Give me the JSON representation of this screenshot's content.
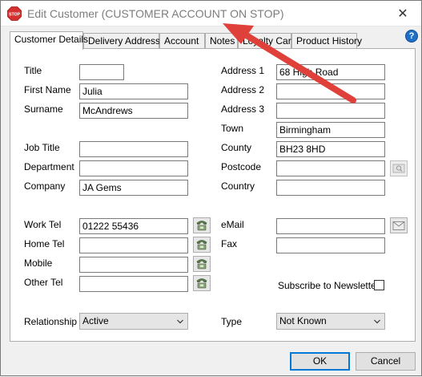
{
  "window": {
    "title": "Edit Customer (CUSTOMER ACCOUNT ON STOP)",
    "stop_badge": "STOP",
    "close_glyph": "✕",
    "help_glyph": "?"
  },
  "tabs": [
    {
      "label": "Customer Details",
      "active": true
    },
    {
      "label": "Delivery Address",
      "active": false
    },
    {
      "label": "Account",
      "active": false
    },
    {
      "label": "Notes",
      "active": false
    },
    {
      "label": "Loyalty Cards",
      "active": false
    },
    {
      "label": "Product History",
      "active": false
    }
  ],
  "left_fields": {
    "title": {
      "label": "Title",
      "value": ""
    },
    "first_name": {
      "label": "First Name",
      "value": "Julia"
    },
    "surname": {
      "label": "Surname",
      "value": "McAndrews"
    },
    "job_title": {
      "label": "Job Title",
      "value": ""
    },
    "department": {
      "label": "Department",
      "value": ""
    },
    "company": {
      "label": "Company",
      "value": "JA Gems"
    },
    "work_tel": {
      "label": "Work Tel",
      "value": "01222 55436"
    },
    "home_tel": {
      "label": "Home Tel",
      "value": ""
    },
    "mobile": {
      "label": "Mobile",
      "value": ""
    },
    "other_tel": {
      "label": "Other Tel",
      "value": ""
    },
    "relationship": {
      "label": "Relationship",
      "value": "Active"
    }
  },
  "right_fields": {
    "address1": {
      "label": "Address 1",
      "value": "68 High Road"
    },
    "address2": {
      "label": "Address 2",
      "value": ""
    },
    "address3": {
      "label": "Address 3",
      "value": ""
    },
    "town": {
      "label": "Town",
      "value": "Birmingham"
    },
    "county": {
      "label": "County",
      "value": "BH23 8HD"
    },
    "postcode": {
      "label": "Postcode",
      "value": ""
    },
    "country": {
      "label": "Country",
      "value": ""
    },
    "email": {
      "label": "eMail",
      "value": ""
    },
    "fax": {
      "label": "Fax",
      "value": ""
    },
    "newsletter": {
      "label": "Subscribe to Newsletter",
      "checked": false
    },
    "type": {
      "label": "Type",
      "value": "Not Known"
    }
  },
  "buttons": {
    "ok": "OK",
    "cancel": "Cancel"
  },
  "icons": {
    "stop": "stop-sign-icon",
    "phone": "phone-icon",
    "email": "envelope-icon",
    "postcode": "postcode-lookup-icon",
    "help": "help-icon",
    "annotation": "red-arrow-annotation"
  },
  "colors": {
    "stop_red": "#d62f2f",
    "arrow_red": "#e0403a",
    "help_blue": "#1f6fc6",
    "default_button_border": "#0078d7"
  }
}
